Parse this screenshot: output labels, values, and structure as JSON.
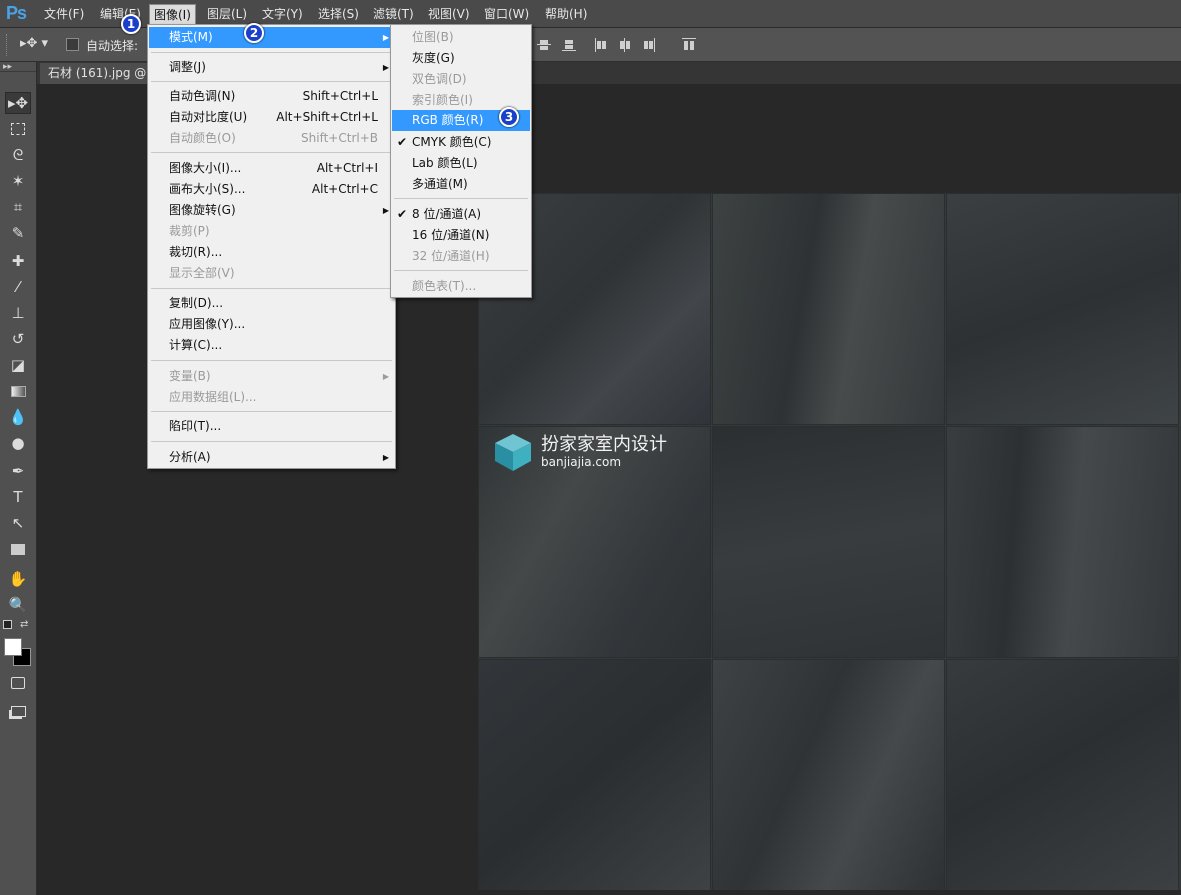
{
  "app": {
    "logo": "Ps"
  },
  "menubar": {
    "items": [
      "文件(F)",
      "编辑(E)",
      "图像(I)",
      "图层(L)",
      "文字(Y)",
      "选择(S)",
      "滤镜(T)",
      "视图(V)",
      "窗口(W)",
      "帮助(H)"
    ],
    "active_index": 2
  },
  "options_bar": {
    "auto_select_label": "自动选择:",
    "auto_select_checked": false
  },
  "document_tab": {
    "label": "石材 (161).jpg @ 5"
  },
  "image_menu": {
    "items": [
      {
        "label": "模式(M)",
        "shortcut": "",
        "submenu": true,
        "highlighted": true,
        "disabled": false
      },
      {
        "label": "调整(J)",
        "shortcut": "",
        "submenu": true,
        "disabled": false
      },
      {
        "label": "自动色调(N)",
        "shortcut": "Shift+Ctrl+L",
        "disabled": false
      },
      {
        "label": "自动对比度(U)",
        "shortcut": "Alt+Shift+Ctrl+L",
        "disabled": false
      },
      {
        "label": "自动颜色(O)",
        "shortcut": "Shift+Ctrl+B",
        "disabled": true
      },
      {
        "label": "图像大小(I)...",
        "shortcut": "Alt+Ctrl+I",
        "disabled": false
      },
      {
        "label": "画布大小(S)...",
        "shortcut": "Alt+Ctrl+C",
        "disabled": false
      },
      {
        "label": "图像旋转(G)",
        "shortcut": "",
        "submenu": true,
        "disabled": false
      },
      {
        "label": "裁剪(P)",
        "shortcut": "",
        "disabled": true
      },
      {
        "label": "裁切(R)...",
        "shortcut": "",
        "disabled": false
      },
      {
        "label": "显示全部(V)",
        "shortcut": "",
        "disabled": true
      },
      {
        "label": "复制(D)...",
        "shortcut": "",
        "disabled": false
      },
      {
        "label": "应用图像(Y)...",
        "shortcut": "",
        "disabled": false
      },
      {
        "label": "计算(C)...",
        "shortcut": "",
        "disabled": false
      },
      {
        "label": "变量(B)",
        "shortcut": "",
        "submenu": true,
        "disabled": true
      },
      {
        "label": "应用数据组(L)...",
        "shortcut": "",
        "disabled": true
      },
      {
        "label": "陷印(T)...",
        "shortcut": "",
        "disabled": false
      },
      {
        "label": "分析(A)",
        "shortcut": "",
        "submenu": true,
        "disabled": false
      }
    ]
  },
  "mode_submenu": {
    "items": [
      {
        "label": "位图(B)",
        "disabled": true
      },
      {
        "label": "灰度(G)",
        "disabled": false
      },
      {
        "label": "双色调(D)",
        "disabled": true
      },
      {
        "label": "索引颜色(I)",
        "disabled": true
      },
      {
        "label": "RGB 颜色(R)",
        "disabled": false,
        "highlighted": true
      },
      {
        "label": "CMYK 颜色(C)",
        "disabled": false,
        "checked": true
      },
      {
        "label": "Lab 颜色(L)",
        "disabled": false
      },
      {
        "label": "多通道(M)",
        "disabled": false
      },
      {
        "label": "8 位/通道(A)",
        "disabled": false,
        "checked": true
      },
      {
        "label": "16 位/通道(N)",
        "disabled": false
      },
      {
        "label": "32 位/通道(H)",
        "disabled": true
      },
      {
        "label": "颜色表(T)...",
        "disabled": true
      }
    ]
  },
  "badges": [
    "1",
    "2",
    "3"
  ],
  "watermark": {
    "title": "扮家家室内设计",
    "url": "banjiajia.com"
  },
  "tools": [
    "move-tool",
    "marquee-tool",
    "lasso-tool",
    "magic-wand-tool",
    "crop-tool",
    "eyedropper-tool",
    "healing-brush-tool",
    "brush-tool",
    "clone-stamp-tool",
    "history-brush-tool",
    "eraser-tool",
    "gradient-tool",
    "blur-tool",
    "dodge-tool",
    "pen-tool",
    "type-tool",
    "path-selection-tool",
    "rectangle-tool",
    "hand-tool",
    "zoom-tool"
  ],
  "colors": {
    "foreground": "#ffffff",
    "background": "#000000",
    "menu_highlight": "#3399ff",
    "badge": "#1a3fc8",
    "watermark_teal": "#3fb0c0"
  }
}
